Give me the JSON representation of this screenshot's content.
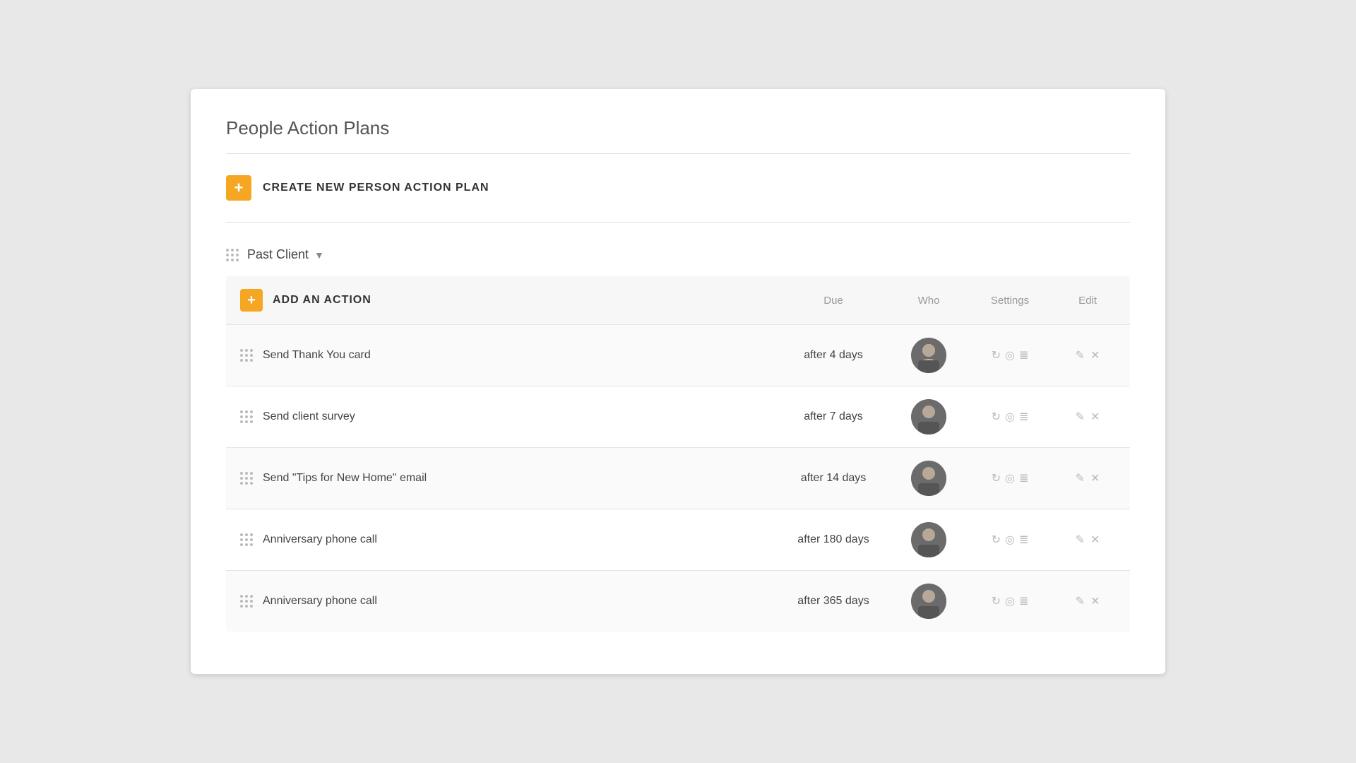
{
  "page": {
    "title": "People Action Plans"
  },
  "create_btn": {
    "label": "CREATE NEW PERSON ACTION PLAN"
  },
  "plan": {
    "name": "Past Client",
    "table": {
      "headers": {
        "add_action": "ADD AN ACTION",
        "due": "Due",
        "who": "Who",
        "settings": "Settings",
        "edit": "Edit"
      },
      "rows": [
        {
          "id": 1,
          "action_name": "Send Thank You card",
          "due": "after 4 days"
        },
        {
          "id": 2,
          "action_name": "Send client survey",
          "due": "after 7 days"
        },
        {
          "id": 3,
          "action_name": "Send \"Tips for New Home\" email",
          "due": "after 14 days"
        },
        {
          "id": 4,
          "action_name": "Anniversary phone call",
          "due": "after 180 days"
        },
        {
          "id": 5,
          "action_name": "Anniversary phone call",
          "due": "after 365 days"
        }
      ]
    }
  },
  "colors": {
    "orange": "#f5a623",
    "text_dark": "#444",
    "text_light": "#999",
    "border": "#ddd"
  }
}
